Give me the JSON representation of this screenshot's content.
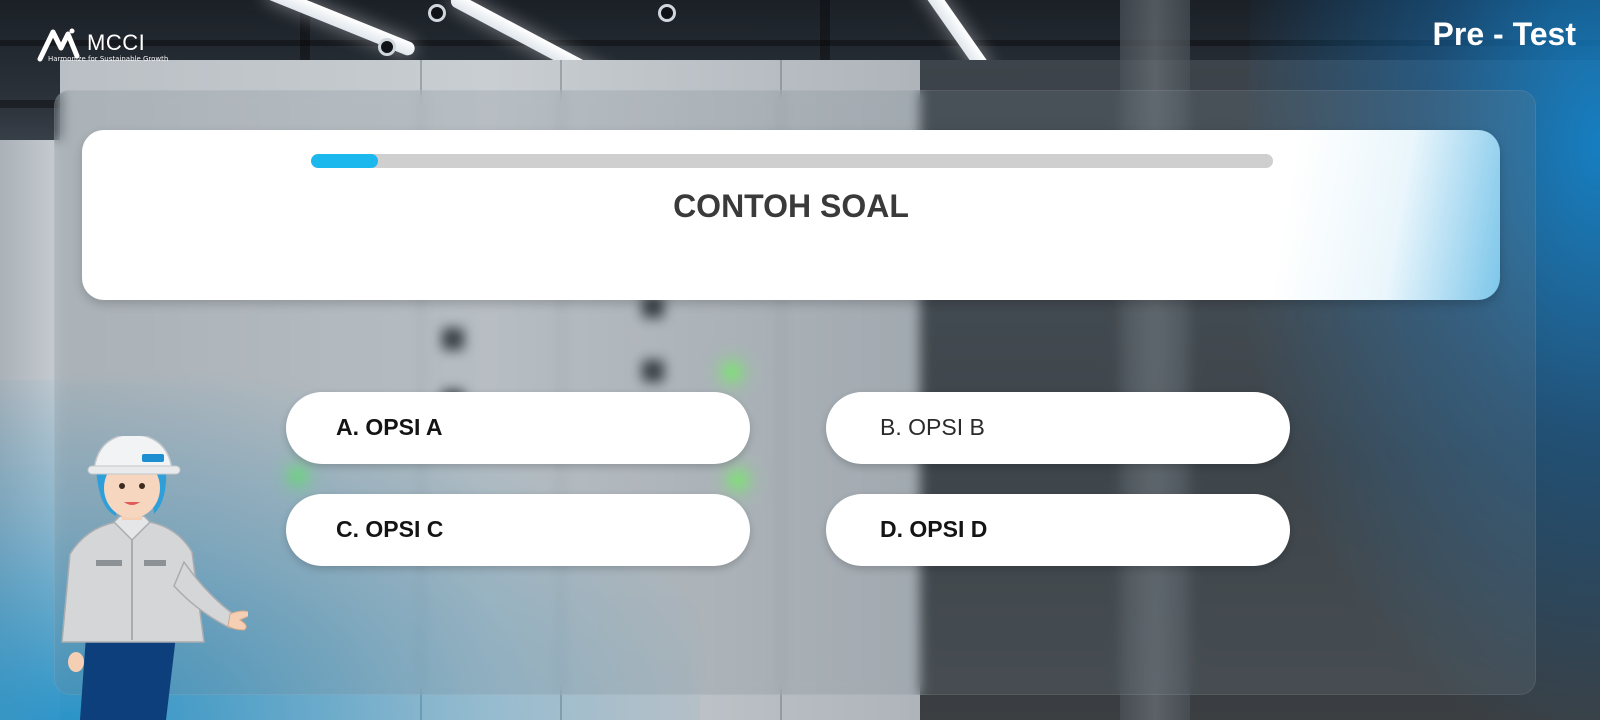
{
  "header": {
    "logo_text": "MCCI",
    "logo_tagline": "Harmonize for Sustainable Growth",
    "page_title": "Pre - Test"
  },
  "quiz": {
    "progress": 0.07,
    "question": "CONTOH SOAL",
    "options": [
      {
        "label": "A. OPSI A"
      },
      {
        "label": "B. OPSI B"
      },
      {
        "label": "C. OPSI C"
      },
      {
        "label": "D. OPSI D"
      }
    ]
  },
  "colors": {
    "accent": "#1bb8ee",
    "progress_track": "#cfcfcf",
    "card": "#ffffff",
    "title_text": "#ffffff"
  },
  "icons": {
    "logo": "mcci-logo-icon",
    "mascot": "mascot-illustration"
  }
}
